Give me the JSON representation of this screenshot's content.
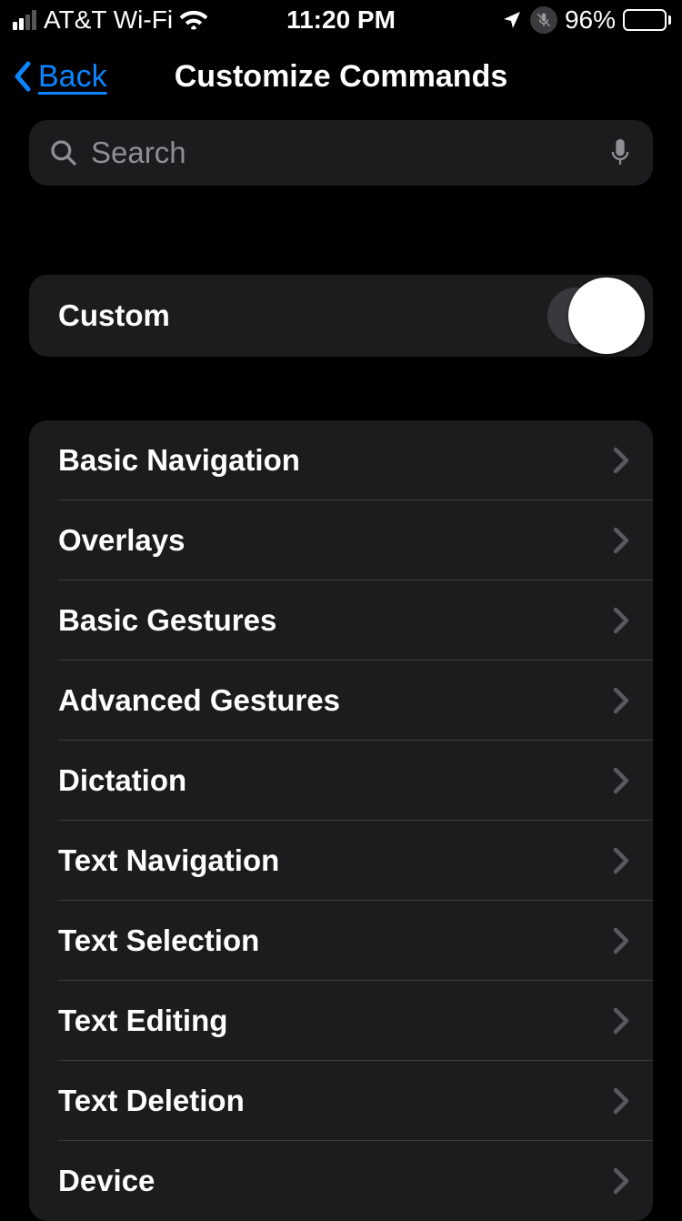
{
  "statusBar": {
    "carrier": "AT&T Wi-Fi",
    "time": "11:20 PM",
    "batteryPercent": "96%"
  },
  "nav": {
    "backLabel": "Back",
    "title": "Customize Commands"
  },
  "search": {
    "placeholder": "Search"
  },
  "customSection": {
    "label": "Custom"
  },
  "categories": [
    {
      "label": "Basic Navigation"
    },
    {
      "label": "Overlays"
    },
    {
      "label": "Basic Gestures"
    },
    {
      "label": "Advanced Gestures"
    },
    {
      "label": "Dictation"
    },
    {
      "label": "Text Navigation"
    },
    {
      "label": "Text Selection"
    },
    {
      "label": "Text Editing"
    },
    {
      "label": "Text Deletion"
    },
    {
      "label": "Device"
    }
  ]
}
